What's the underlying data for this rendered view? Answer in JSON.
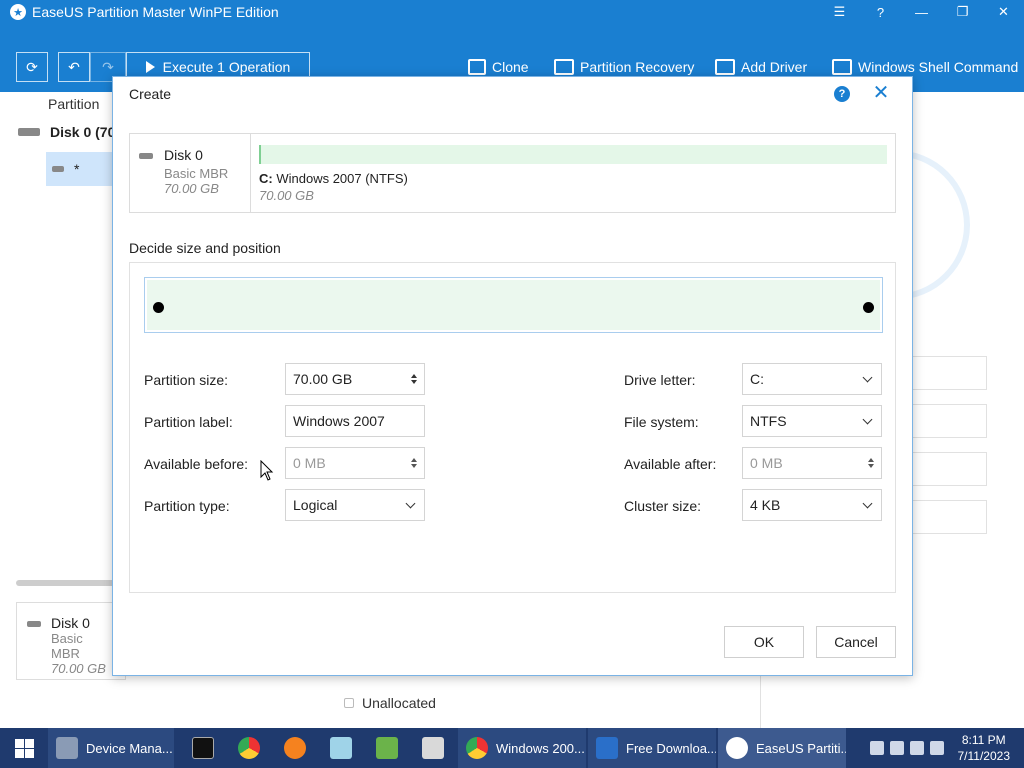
{
  "app": {
    "title": "EaseUS Partition Master WinPE Edition",
    "window_controls": [
      "menu-icon",
      "help-icon",
      "minimize-icon",
      "restore-icon",
      "close-icon"
    ]
  },
  "toolbar": {
    "execute_label": "Execute 1 Operation",
    "clone_label": "Clone",
    "recovery_label": "Partition Recovery",
    "add_driver_label": "Add Driver",
    "shell_label": "Windows Shell Command"
  },
  "background": {
    "column_header": "Partition",
    "disk_label": "Disk 0 (70",
    "selected_row": "*",
    "card_name": "Disk 0",
    "card_type": "Basic MBR",
    "card_size": "70.00 GB",
    "unallocated_label": "Unallocated"
  },
  "dialog": {
    "title": "Create",
    "disk": {
      "name": "Disk 0",
      "type": "Basic MBR",
      "size": "70.00 GB"
    },
    "partition": {
      "letter": "C:",
      "name": "Windows 2007 (NTFS)",
      "size": "70.00 GB"
    },
    "section_title": "Decide size and position",
    "fields": {
      "partition_size": {
        "label": "Partition size:",
        "value": "70.00 GB"
      },
      "partition_label": {
        "label": "Partition label:",
        "value": "Windows 2007"
      },
      "available_before": {
        "label": "Available before:",
        "value": "0 MB"
      },
      "partition_type": {
        "label": "Partition type:",
        "value": "Logical"
      },
      "drive_letter": {
        "label": "Drive letter:",
        "value": "C:"
      },
      "file_system": {
        "label": "File system:",
        "value": "NTFS"
      },
      "available_after": {
        "label": "Available after:",
        "value": "0 MB"
      },
      "cluster_size": {
        "label": "Cluster size:",
        "value": "4 KB"
      }
    },
    "ok_label": "OK",
    "cancel_label": "Cancel"
  },
  "taskbar": {
    "tasks": [
      {
        "label": "Device Mana...",
        "icon": "device-manager-icon"
      },
      {
        "label": "Windows 200...",
        "icon": "chrome-icon"
      },
      {
        "label": "Free Downloa...",
        "icon": "browser-icon"
      },
      {
        "label": "EaseUS Partiti...",
        "icon": "easeus-icon"
      }
    ],
    "pinned": [
      "terminal-icon",
      "chrome-icon",
      "firefox-icon",
      "notepad-icon",
      "editor-icon",
      "paint-icon"
    ],
    "time": "8:11 PM",
    "date": "7/11/2023"
  },
  "colors": {
    "accent": "#1a7fd1",
    "taskbar": "#1f3a6e",
    "partition_fill": "#e4f7e8"
  }
}
